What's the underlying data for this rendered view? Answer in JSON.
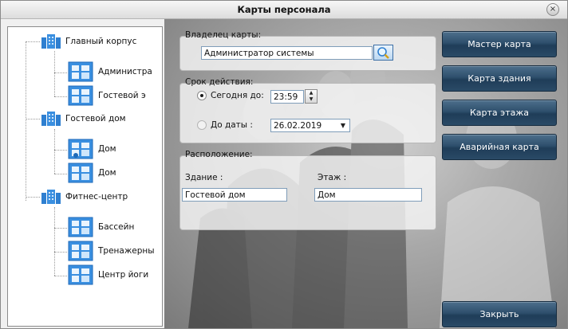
{
  "window": {
    "title": "Карты персонала",
    "close_glyph": "×"
  },
  "tree": {
    "items": [
      {
        "label": "Главный корпус",
        "icon": "building-icon"
      },
      {
        "label": "Администра",
        "icon": "floor-icon"
      },
      {
        "label": "Гостевой э",
        "icon": "floor-icon"
      },
      {
        "label": "Гостевой дом",
        "icon": "building-icon"
      },
      {
        "label": "Дом",
        "icon": "floor-icon"
      },
      {
        "label": "Дом",
        "icon": "floor-icon"
      },
      {
        "label": "Фитнес-центр",
        "icon": "building-icon"
      },
      {
        "label": "Бассейн",
        "icon": "floor-icon"
      },
      {
        "label": "Тренажерны",
        "icon": "floor-icon"
      },
      {
        "label": "Центр йоги",
        "icon": "floor-icon"
      }
    ]
  },
  "owner": {
    "label": "Владелец карты:",
    "value": "Администратор системы"
  },
  "validity": {
    "label": "Срок действия:",
    "today_label": "Сегодня до:",
    "today_time": "23:59",
    "until_label": "До даты :",
    "until_date": "26.02.2019",
    "selected": "today"
  },
  "location": {
    "label": "Расположение:",
    "building_label": "Здание :",
    "building_value": "Гостевой дом",
    "floor_label": "Этаж :",
    "floor_value": "Дом"
  },
  "buttons": {
    "master": "Мастер карта",
    "building": "Карта здания",
    "floor": "Карта этажа",
    "emergency": "Аварийная карта",
    "close": "Закрыть"
  },
  "colors": {
    "button_bg": "#2e4f6c",
    "tree_icon_blue": "#2f7fd0"
  }
}
